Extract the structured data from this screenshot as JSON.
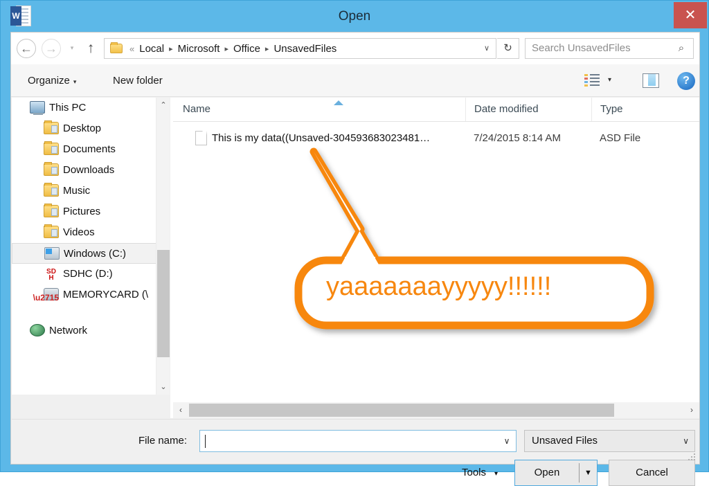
{
  "window": {
    "title": "Open",
    "app_icon": "word-icon",
    "app_icon_letter": "W",
    "close_label": "✕",
    "frame_color": "#5CB8E8"
  },
  "nav": {
    "back_icon": "←",
    "forward_icon": "→",
    "history_icon": "▾",
    "up_icon": "↑",
    "refresh_icon": "↻",
    "address_overflow": "«",
    "breadcrumbs": [
      "Local",
      "Microsoft",
      "Office",
      "UnsavedFiles"
    ],
    "breadcrumb_sep": "▸",
    "address_dropdown_icon": "∨"
  },
  "search": {
    "placeholder": "Search UnsavedFiles",
    "icon": "⌕"
  },
  "commandbar": {
    "organize_label": "Organize",
    "organize_caret": "▾",
    "new_folder_label": "New folder",
    "view_caret": "▾",
    "help_label": "?"
  },
  "sidebar": {
    "items": [
      {
        "label": "This PC",
        "icon": "computer-icon",
        "level": 0,
        "selected": false
      },
      {
        "label": "Desktop",
        "icon": "folder-desktop-icon",
        "level": 1,
        "selected": false
      },
      {
        "label": "Documents",
        "icon": "folder-documents-icon",
        "level": 1,
        "selected": false
      },
      {
        "label": "Downloads",
        "icon": "folder-downloads-icon",
        "level": 1,
        "selected": false
      },
      {
        "label": "Music",
        "icon": "folder-music-icon",
        "level": 1,
        "selected": false
      },
      {
        "label": "Pictures",
        "icon": "folder-pictures-icon",
        "level": 1,
        "selected": false
      },
      {
        "label": "Videos",
        "icon": "folder-videos-icon",
        "level": 1,
        "selected": false
      },
      {
        "label": "Windows (C:)",
        "icon": "hard-drive-icon",
        "level": 1,
        "selected": true
      },
      {
        "label": "SDHC (D:)",
        "icon": "sd-card-icon",
        "level": 1,
        "selected": false
      },
      {
        "label": "MEMORYCARD (\\",
        "icon": "network-drive-disconnected-icon",
        "level": 1,
        "selected": false
      },
      {
        "label": "Network",
        "icon": "network-icon",
        "level": 0,
        "selected": false
      }
    ],
    "scroll_up_icon": "⌃",
    "scroll_down_icon": "⌄"
  },
  "filelist": {
    "columns": [
      "Name",
      "Date modified",
      "Type"
    ],
    "sorted_column": "Name",
    "rows": [
      {
        "name": "This is my data((Unsaved-304593683023481…",
        "date_modified": "7/24/2015 8:14 AM",
        "type": "ASD File",
        "icon": "document-icon"
      }
    ],
    "hscroll_left_icon": "‹",
    "hscroll_right_icon": "›"
  },
  "footer": {
    "file_name_label": "File name:",
    "file_name_value": "",
    "file_name_dropdown_icon": "∨",
    "filter_value": "Unsaved Files",
    "filter_dropdown_icon": "∨",
    "tools_label": "Tools",
    "tools_caret": "▾",
    "open_label": "Open",
    "open_split_caret": "▼",
    "cancel_label": "Cancel"
  },
  "annotation": {
    "text": "yaaaaaaayyyyy!!!!!!",
    "color": "#F7870F",
    "shape": "speech-bubble-with-pointer"
  }
}
